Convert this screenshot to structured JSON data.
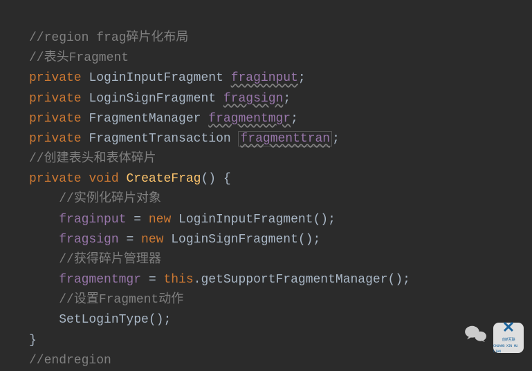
{
  "lines": {
    "l1_comment": "//region frag碎片化布局",
    "l2_comment": "//表头Fragment",
    "l3_kw": "private",
    "l3_type": "LoginInputFragment",
    "l3_field": "fraginput",
    "l3_semi": ";",
    "l4_kw": "private",
    "l4_type": "LoginSignFragment",
    "l4_field": "fragsign",
    "l4_semi": ";",
    "l5_kw": "private",
    "l5_type": "FragmentManager",
    "l5_field": "fragmentmgr",
    "l5_semi": ";",
    "l6_kw": "private",
    "l6_type": "FragmentTransaction",
    "l6_field": "fragmenttran",
    "l6_semi": ";",
    "l7_comment": "//创建表头和表体碎片",
    "l8_kw1": "private",
    "l8_kw2": "void",
    "l8_method": "CreateFrag",
    "l8_parens": "()",
    "l8_brace": " {",
    "l9_comment": "//实例化碎片对象",
    "l10_field": "fraginput",
    "l10_eq": " = ",
    "l10_kw": "new",
    "l10_type": " LoginInputFragment()",
    "l10_semi": ";",
    "l11_field": "fragsign",
    "l11_eq": " = ",
    "l11_kw": "new",
    "l11_type": " LoginSignFragment()",
    "l11_semi": ";",
    "l12_comment": "//获得碎片管理器",
    "l13_field": "fragmentmgr",
    "l13_eq": " = ",
    "l13_kw": "this",
    "l13_call": ".getSupportFragmentManager()",
    "l13_semi": ";",
    "l14_comment": "//设置Fragment动作",
    "l15_call": "SetLoginType()",
    "l15_semi": ";",
    "l16_brace": "}",
    "l17_comment": "//endregion"
  },
  "watermark": {
    "logo_text_top": "创新互联",
    "logo_text_bottom": "CHUANG XIN HU LIAN"
  }
}
